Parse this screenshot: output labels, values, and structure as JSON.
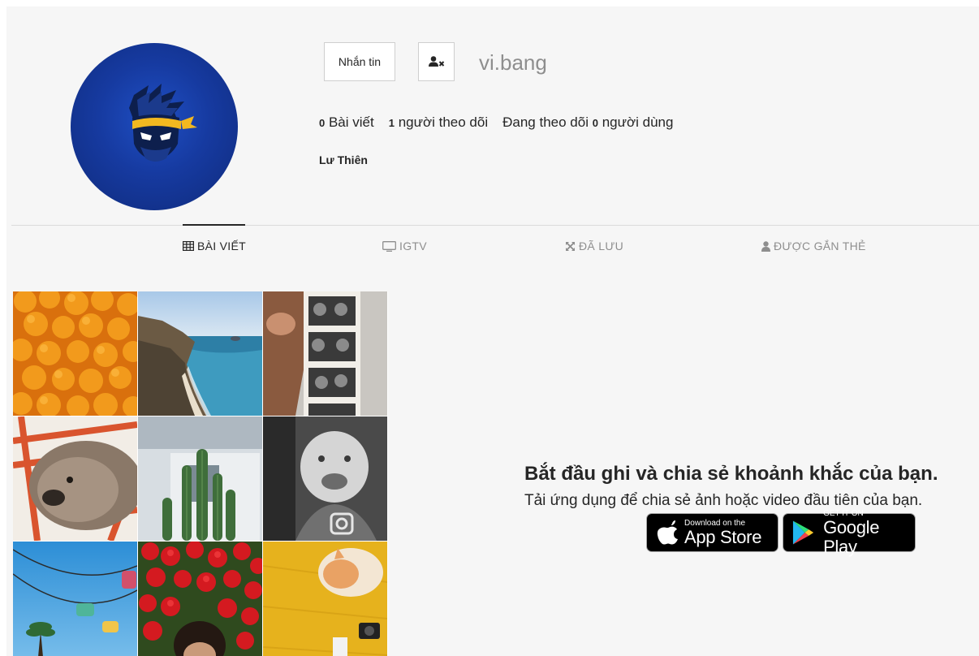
{
  "profile": {
    "username": "vi.bang",
    "full_name": "Lư Thiên",
    "message_button": "Nhắn tin",
    "unfollow_icon": "user-times-icon",
    "stats": {
      "posts_count": "0",
      "posts_label": "Bài viết",
      "followers_count": "1",
      "followers_label": "người theo dõi",
      "following_prefix": "Đang theo dõi",
      "following_count": "0",
      "following_suffix": "người dùng"
    }
  },
  "tabs": [
    {
      "label": "BÀI VIẾT",
      "icon": "table-grid-icon",
      "active": true
    },
    {
      "label": "IGTV",
      "icon": "tv-icon",
      "active": false
    },
    {
      "label": "ĐÃ LƯU",
      "icon": "expand-icon",
      "active": false
    },
    {
      "label": "ĐƯỢC GẮN THẺ",
      "icon": "user-icon",
      "active": false
    }
  ],
  "empty_state": {
    "title": "Bắt đầu ghi và chia sẻ khoảnh khắc của bạn.",
    "subtitle": "Tải ứng dụng để chia sẻ ảnh hoặc video đầu tiên của bạn.",
    "app_store": {
      "small": "Download on the",
      "big": "App Store"
    },
    "google_play": {
      "small": "GET IT ON",
      "big": "Google Play"
    }
  },
  "colors": {
    "background": "#f6f6f6",
    "text": "#262626",
    "muted": "#8e8e8e",
    "avatar_blue": "#163aa0"
  }
}
